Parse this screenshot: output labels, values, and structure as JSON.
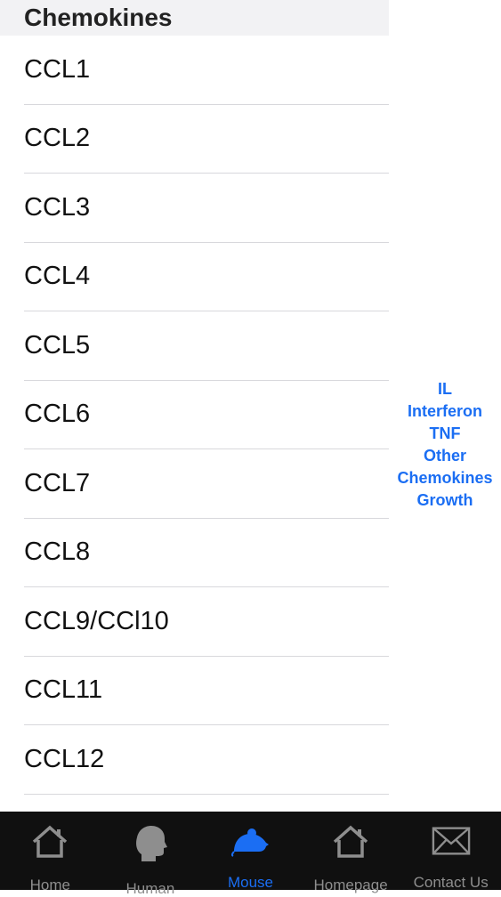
{
  "section": {
    "title": "Chemokines"
  },
  "list": {
    "items": [
      "CCL1",
      "CCL2",
      "CCL3",
      "CCL4",
      "CCL5",
      "CCL6",
      "CCL7",
      "CCL8",
      "CCL9/CCl10",
      "CCL11",
      "CCL12"
    ]
  },
  "index": {
    "items": [
      "IL",
      "Interferon",
      "TNF",
      "Other",
      "Chemokines",
      "Growth"
    ]
  },
  "tabbar": {
    "active_tab": "Mouse",
    "tabs": [
      {
        "label": "Home",
        "icon": "house-icon"
      },
      {
        "label": "Human",
        "icon": "human-head-icon"
      },
      {
        "label": "Mouse",
        "icon": "mouse-icon"
      },
      {
        "label": "Homepage",
        "icon": "house-icon"
      },
      {
        "label": "Contact Us",
        "icon": "envelope-icon"
      }
    ]
  },
  "colors": {
    "accent": "#1b6ef3",
    "tab_inactive": "#8e8e8e",
    "tabbar_bg": "#101010",
    "header_bg": "#f2f2f4"
  }
}
